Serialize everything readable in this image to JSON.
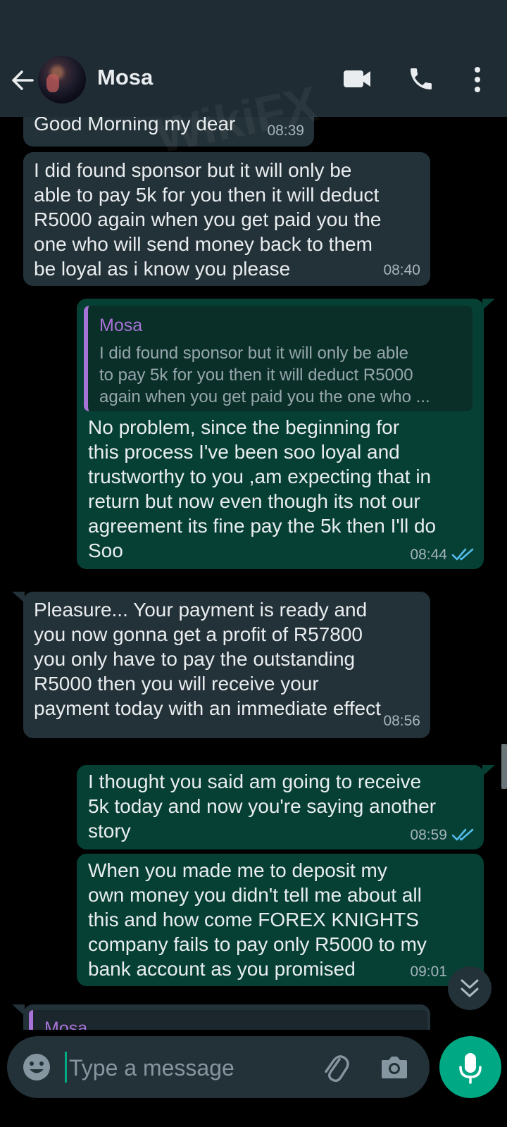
{
  "header": {
    "contact_name": "Mosa",
    "back_icon": "arrow-left-icon",
    "video_icon": "video-camera-icon",
    "call_icon": "phone-icon",
    "menu_icon": "more-vertical-icon"
  },
  "messages": [
    {
      "dir": "in",
      "text": "Good Morning my dear",
      "time": "08:39"
    },
    {
      "dir": "in",
      "text": "I did found sponsor but it will only be\nable to pay 5k for you then it will deduct\nR5000 again when you get paid you the\none who will send money back to them\nbe loyal as i know you please",
      "time": "08:40"
    },
    {
      "dir": "out",
      "quote": {
        "author": "Mosa",
        "text": "I did found sponsor but it will only be able\nto pay 5k for you then it will deduct R5000\nagain when you get paid you the one who ..."
      },
      "text": "No problem, since the beginning for\nthis process I've been soo loyal and\ntrustworthy to you ,am expecting that in\nreturn but now even though its not our\nagreement its fine pay the 5k then I'll do\nSoo",
      "time": "08:44"
    },
    {
      "dir": "in",
      "text": "Pleasure... Your payment is ready and\nyou now gonna get a profit of R57800\nyou only have to pay the outstanding\nR5000 then you will receive your\npayment today with an immediate effect",
      "time": "08:56"
    },
    {
      "dir": "out",
      "text": "I thought you said am going to receive\n5k today and now you're saying another\nstory",
      "time": "08:59"
    },
    {
      "dir": "out",
      "text": "When you made me to deposit my\nown money you didn't tell me about all\nthis and how come FOREX KNIGHTS\ncompany fails to pay only R5000 to my\nbank account as you promised",
      "time": "09:01"
    },
    {
      "dir": "in",
      "quote_author_partial": "Mosa"
    }
  ],
  "input": {
    "placeholder": "Type a message",
    "emoji_icon": "emoji-icon",
    "attach_icon": "paperclip-icon",
    "camera_icon": "camera-icon",
    "mic_icon": "microphone-icon"
  },
  "scroll_down_icon": "chevron-double-down-icon",
  "watermark": "WikiFX",
  "colors": {
    "app_bar": "#1f2c34",
    "incoming_bubble": "#233138",
    "outgoing_bubble": "#064035",
    "accent": "#00a884",
    "quote_author": "#a873d6",
    "read_ticks": "#53bdeb"
  }
}
